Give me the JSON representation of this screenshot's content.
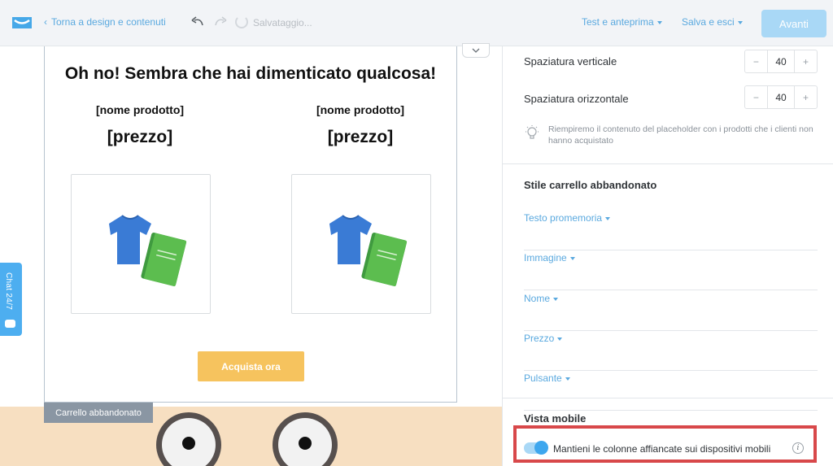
{
  "topbar": {
    "back_link": "Torna a design e contenuti",
    "saving_status": "Salvataggio...",
    "preview_menu": "Test e anteprima",
    "save_menu": "Salva e esci",
    "next_button": "Avanti"
  },
  "email": {
    "headline": "Oh no! Sembra che hai dimenticato qualcosa!",
    "products": [
      {
        "name": "[nome prodotto]",
        "price": "[prezzo]"
      },
      {
        "name": "[nome prodotto]",
        "price": "[prezzo]"
      }
    ],
    "buy_button": "Acquista ora",
    "block_label": "Carrello abbandonato"
  },
  "chat": {
    "label": "Chat 24/7"
  },
  "panel": {
    "vertical_spacing": {
      "label": "Spaziatura verticale",
      "value": "40"
    },
    "horizontal_spacing": {
      "label": "Spaziatura orizzontale",
      "value": "40"
    },
    "stepper_minus": "−",
    "stepper_plus": "+",
    "hint": "Riempiremo il contenuto del placeholder con i prodotti che i clienti non hanno acquistato",
    "cart_style_title": "Stile carrello abbandonato",
    "cart_style_items": [
      "Testo promemoria",
      "Immagine",
      "Nome",
      "Prezzo",
      "Pulsante"
    ],
    "mobile_title": "Vista mobile",
    "mobile_toggle_label": "Mantieni le colonne affiancate sui dispositivi mobili",
    "mobile_toggle_on": true
  },
  "colors": {
    "accent": "#5aa9df",
    "button_yellow": "#f6c35e",
    "highlight_red": "#d8484a"
  }
}
